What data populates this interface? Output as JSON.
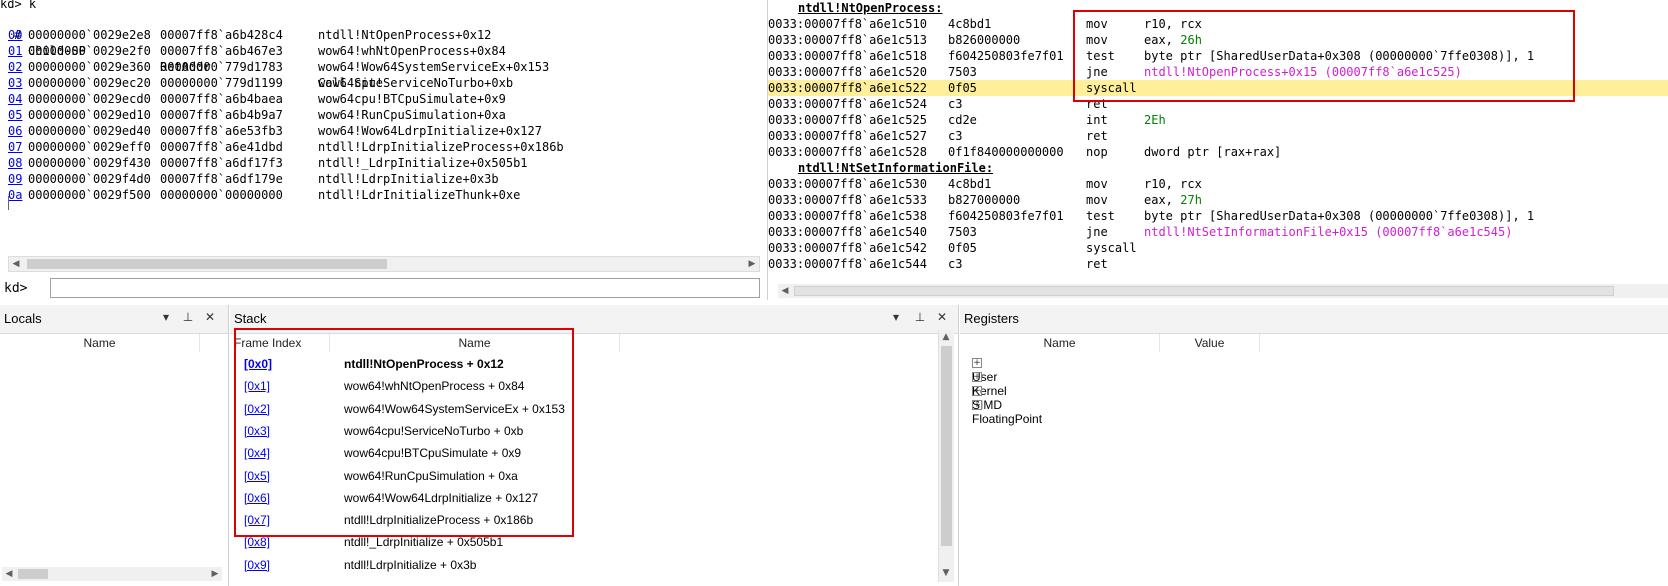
{
  "command_window": {
    "echo": "kd> k",
    "headers": [
      "#",
      "Child-SP",
      "RetAddr",
      "Call Site"
    ],
    "frames": [
      {
        "num": "00",
        "sp": "00000000`0029e2e8",
        "ret": "00007ff8`a6b428c4",
        "site": "ntdll!NtOpenProcess+0x12"
      },
      {
        "num": "01",
        "sp": "00000000`0029e2f0",
        "ret": "00007ff8`a6b467e3",
        "site": "wow64!whNtOpenProcess+0x84"
      },
      {
        "num": "02",
        "sp": "00000000`0029e360",
        "ret": "00000000`779d1783",
        "site": "wow64!Wow64SystemServiceEx+0x153"
      },
      {
        "num": "03",
        "sp": "00000000`0029ec20",
        "ret": "00000000`779d1199",
        "site": "wow64cpu!ServiceNoTurbo+0xb"
      },
      {
        "num": "04",
        "sp": "00000000`0029ecd0",
        "ret": "00007ff8`a6b4baea",
        "site": "wow64cpu!BTCpuSimulate+0x9"
      },
      {
        "num": "05",
        "sp": "00000000`0029ed10",
        "ret": "00007ff8`a6b4b9a7",
        "site": "wow64!RunCpuSimulation+0xa"
      },
      {
        "num": "06",
        "sp": "00000000`0029ed40",
        "ret": "00007ff8`a6e53fb3",
        "site": "wow64!Wow64LdrpInitialize+0x127"
      },
      {
        "num": "07",
        "sp": "00000000`0029eff0",
        "ret": "00007ff8`a6e41dbd",
        "site": "ntdll!LdrpInitializeProcess+0x186b"
      },
      {
        "num": "08",
        "sp": "00000000`0029f430",
        "ret": "00007ff8`a6df17f3",
        "site": "ntdll!_LdrpInitialize+0x505b1"
      },
      {
        "num": "09",
        "sp": "00000000`0029f4d0",
        "ret": "00007ff8`a6df179e",
        "site": "ntdll!LdrpInitialize+0x3b"
      },
      {
        "num": "0a",
        "sp": "00000000`0029f500",
        "ret": "00000000`00000000",
        "site": "ntdll!LdrInitializeThunk+0xe"
      }
    ],
    "prompt": "kd>",
    "input_value": ""
  },
  "disassembly": {
    "label1": "ntdll!NtOpenProcess:",
    "label2": "ntdll!NtSetInformationFile:",
    "lines": [
      {
        "addr": "0033:00007ff8`a6e1c510",
        "bytes": "4c8bd1",
        "op": "mov",
        "a": "r10, rcx",
        "b": "",
        "c": ""
      },
      {
        "addr": "0033:00007ff8`a6e1c513",
        "bytes": "b826000000",
        "op": "mov",
        "a": "eax, ",
        "b": "26h",
        "c": ""
      },
      {
        "addr": "0033:00007ff8`a6e1c518",
        "bytes": "f604250803fe7f01",
        "op": "test",
        "a": "byte ptr [SharedUserData+0x308 (00000000`7ffe0308)], 1",
        "b": "",
        "c": ""
      },
      {
        "addr": "0033:00007ff8`a6e1c520",
        "bytes": "7503",
        "op": "jne",
        "a": "",
        "b": "",
        "c": "ntdll!NtOpenProcess+0x15 (00007ff8`a6e1c525)"
      },
      {
        "addr": "0033:00007ff8`a6e1c522",
        "bytes": "0f05",
        "op": "syscall",
        "a": "",
        "b": "",
        "c": ""
      },
      {
        "addr": "0033:00007ff8`a6e1c524",
        "bytes": "c3",
        "op": "ret",
        "a": "",
        "b": "",
        "c": ""
      },
      {
        "addr": "0033:00007ff8`a6e1c525",
        "bytes": "cd2e",
        "op": "int",
        "a": "",
        "b": "2Eh",
        "c": ""
      },
      {
        "addr": "0033:00007ff8`a6e1c527",
        "bytes": "c3",
        "op": "ret",
        "a": "",
        "b": "",
        "c": ""
      },
      {
        "addr": "0033:00007ff8`a6e1c528",
        "bytes": "0f1f840000000000",
        "op": "nop",
        "a": "dword ptr [rax+rax]",
        "b": "",
        "c": ""
      },
      {
        "addr": "0033:00007ff8`a6e1c530",
        "bytes": "4c8bd1",
        "op": "mov",
        "a": "r10, rcx",
        "b": "",
        "c": ""
      },
      {
        "addr": "0033:00007ff8`a6e1c533",
        "bytes": "b827000000",
        "op": "mov",
        "a": "eax, ",
        "b": "27h",
        "c": ""
      },
      {
        "addr": "0033:00007ff8`a6e1c538",
        "bytes": "f604250803fe7f01",
        "op": "test",
        "a": "byte ptr [SharedUserData+0x308 (00000000`7ffe0308)], 1",
        "b": "",
        "c": ""
      },
      {
        "addr": "0033:00007ff8`a6e1c540",
        "bytes": "7503",
        "op": "jne",
        "a": "",
        "b": "",
        "c": "ntdll!NtSetInformationFile+0x15 (00007ff8`a6e1c545)"
      },
      {
        "addr": "0033:00007ff8`a6e1c542",
        "bytes": "0f05",
        "op": "syscall",
        "a": "",
        "b": "",
        "c": ""
      },
      {
        "addr": "0033:00007ff8`a6e1c544",
        "bytes": "c3",
        "op": "ret",
        "a": "",
        "b": "",
        "c": ""
      }
    ],
    "highlight_color": "#ffef9a"
  },
  "locals": {
    "title": "Locals",
    "col_name": "Name"
  },
  "stack": {
    "title": "Stack",
    "col_frame": "Frame Index",
    "col_name": "Name",
    "rows": [
      {
        "idx": "[0x0]",
        "name": "ntdll!NtOpenProcess + 0x12"
      },
      {
        "idx": "[0x1]",
        "name": "wow64!whNtOpenProcess + 0x84"
      },
      {
        "idx": "[0x2]",
        "name": "wow64!Wow64SystemServiceEx + 0x153"
      },
      {
        "idx": "[0x3]",
        "name": "wow64cpu!ServiceNoTurbo + 0xb"
      },
      {
        "idx": "[0x4]",
        "name": "wow64cpu!BTCpuSimulate + 0x9"
      },
      {
        "idx": "[0x5]",
        "name": "wow64!RunCpuSimulation + 0xa"
      },
      {
        "idx": "[0x6]",
        "name": "wow64!Wow64LdrpInitialize + 0x127"
      },
      {
        "idx": "[0x7]",
        "name": "ntdll!LdrpInitializeProcess + 0x186b"
      },
      {
        "idx": "[0x8]",
        "name": "ntdll!_LdrpInitialize + 0x505b1"
      },
      {
        "idx": "[0x9]",
        "name": "ntdll!LdrpInitialize + 0x3b"
      }
    ]
  },
  "registers": {
    "title": "Registers",
    "col_name": "Name",
    "col_value": "Value",
    "groups": [
      "User",
      "Kernel",
      "SIMD",
      "FloatingPoint"
    ]
  },
  "colors": {
    "link": "#0000ee",
    "annotation_red": "#e00000",
    "magenta": "#d01fd0",
    "green": "#008000"
  }
}
